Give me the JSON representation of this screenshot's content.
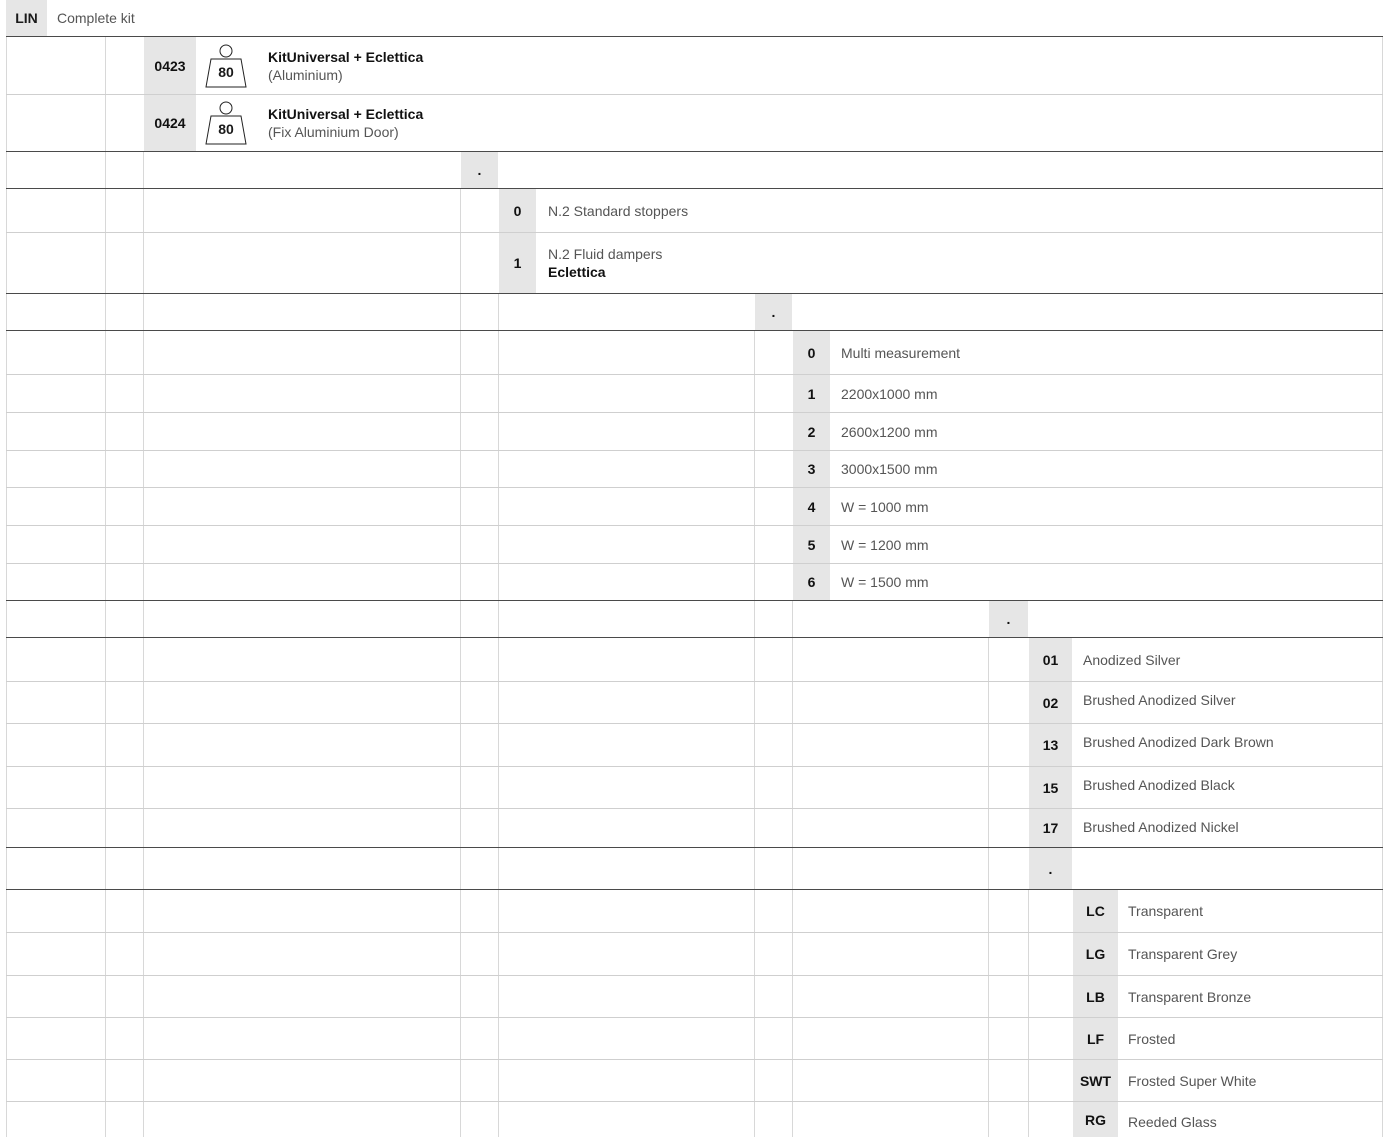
{
  "header": {
    "code": "LIN",
    "label": "Complete kit"
  },
  "kits": [
    {
      "code": "0423",
      "weight": "80",
      "title": "KitUniversal + Eclettica",
      "subtitle": "(Aluminium)"
    },
    {
      "code": "0424",
      "weight": "80",
      "title": "KitUniversal + Eclettica",
      "subtitle": "(Fix Aluminium Door)"
    }
  ],
  "separator": ".",
  "stoppers": [
    {
      "code": "0",
      "label": "N.2 Standard stoppers"
    },
    {
      "code": "1",
      "label": "N.2 Fluid dampers",
      "sublabel": "Eclettica"
    }
  ],
  "measurements": [
    {
      "code": "0",
      "label": "Multi measurement"
    },
    {
      "code": "1",
      "label": "2200x1000 mm"
    },
    {
      "code": "2",
      "label": "2600x1200 mm"
    },
    {
      "code": "3",
      "label": "3000x1500 mm"
    },
    {
      "code": "4",
      "label": "W = 1000 mm"
    },
    {
      "code": "5",
      "label": "W = 1200 mm"
    },
    {
      "code": "6",
      "label": "W = 1500 mm"
    }
  ],
  "finishes": [
    {
      "code": "01",
      "label": "Anodized Silver"
    },
    {
      "code": "02",
      "label": "Brushed Anodized Silver"
    },
    {
      "code": "13",
      "label": "Brushed Anodized Dark Brown"
    },
    {
      "code": "15",
      "label": "Brushed Anodized Black"
    },
    {
      "code": "17",
      "label": "Brushed Anodized Nickel"
    }
  ],
  "glass": [
    {
      "code": "LC",
      "label": "Transparent"
    },
    {
      "code": "LG",
      "label": "Transparent Grey"
    },
    {
      "code": "LB",
      "label": "Transparent Bronze"
    },
    {
      "code": "LF",
      "label": "Frosted"
    },
    {
      "code": "SWT",
      "label": "Frosted Super White"
    },
    {
      "code": "RG",
      "label": "Reeded Glass"
    }
  ],
  "colors": {
    "code_bg": "#e6e6e6",
    "rule_dark": "#4a4a4a",
    "rule_light": "#cfcfcf"
  }
}
